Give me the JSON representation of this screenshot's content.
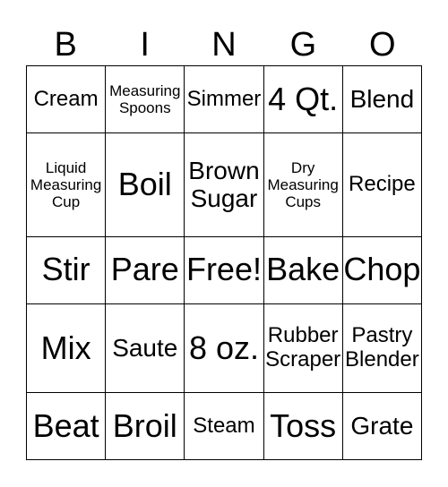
{
  "header": [
    "B",
    "I",
    "N",
    "G",
    "O"
  ],
  "rows": [
    [
      {
        "text": "Cream",
        "size": "s3"
      },
      {
        "text": "Measuring Spoons",
        "size": "s4"
      },
      {
        "text": "Simmer",
        "size": "s3"
      },
      {
        "text": "4 Qt.",
        "size": "s1"
      },
      {
        "text": "Blend",
        "size": "s2"
      }
    ],
    [
      {
        "text": "Liquid Measuring Cup",
        "size": "s4"
      },
      {
        "text": "Boil",
        "size": "s1"
      },
      {
        "text": "Brown Sugar",
        "size": "s2"
      },
      {
        "text": "Dry Measuring Cups",
        "size": "s4"
      },
      {
        "text": "Recipe",
        "size": "s3"
      }
    ],
    [
      {
        "text": "Stir",
        "size": "s1"
      },
      {
        "text": "Pare",
        "size": "s1"
      },
      {
        "text": "Free!",
        "size": "s1"
      },
      {
        "text": "Bake",
        "size": "s1"
      },
      {
        "text": "Chop",
        "size": "s1"
      }
    ],
    [
      {
        "text": "Mix",
        "size": "s1"
      },
      {
        "text": "Saute",
        "size": "s2"
      },
      {
        "text": "8 oz.",
        "size": "s1"
      },
      {
        "text": "Rubber Scraper",
        "size": "s3"
      },
      {
        "text": "Pastry Blender",
        "size": "s3"
      }
    ],
    [
      {
        "text": "Beat",
        "size": "s1"
      },
      {
        "text": "Broil",
        "size": "s1"
      },
      {
        "text": "Steam",
        "size": "s3"
      },
      {
        "text": "Toss",
        "size": "s1"
      },
      {
        "text": "Grate",
        "size": "s2"
      }
    ]
  ]
}
